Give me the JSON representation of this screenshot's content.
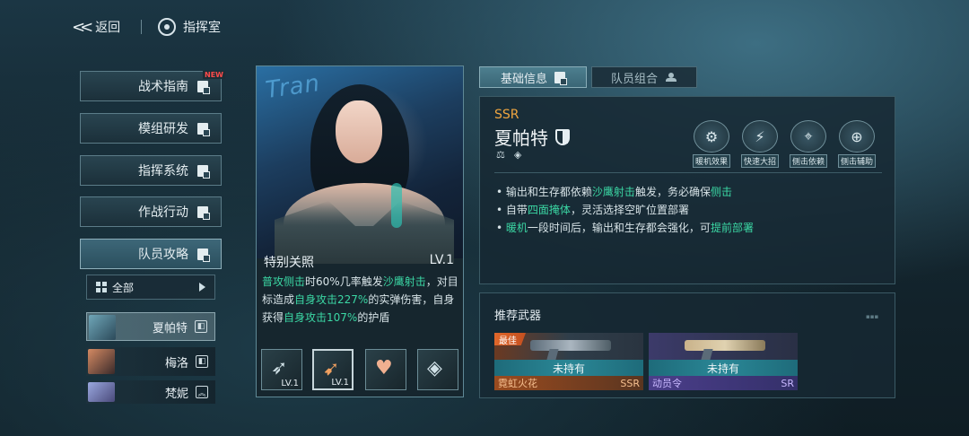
{
  "header": {
    "back_label": "返回",
    "location_label": "指挥室"
  },
  "menu": {
    "new_badge": "NEW",
    "items": [
      {
        "label": "战术指南"
      },
      {
        "label": "模组研发"
      },
      {
        "label": "指挥系统"
      },
      {
        "label": "作战行动"
      },
      {
        "label": "队员攻略"
      }
    ],
    "active_index": 4,
    "filter_label": "全部"
  },
  "characters": [
    {
      "name": "夏帕特",
      "selected": true
    },
    {
      "name": "梅洛",
      "selected": false
    },
    {
      "name": "梵妮",
      "selected": false
    }
  ],
  "skill": {
    "name": "特别关照",
    "level": "LV.1",
    "desc": [
      {
        "t": "普攻侧击",
        "hl": true
      },
      {
        "t": "时60%几率触发",
        "hl": false
      },
      {
        "t": "沙鹰射击",
        "hl": true
      },
      {
        "t": "，对目标造成",
        "hl": false
      },
      {
        "t": "自身攻击227%",
        "hl": true
      },
      {
        "t": "的实弹伤害，自身获得",
        "hl": false
      },
      {
        "t": "自身攻击107%",
        "hl": true
      },
      {
        "t": "的护盾",
        "hl": false
      }
    ],
    "slots": [
      {
        "icon": "arrows-skill-icon",
        "level": "LV.1"
      },
      {
        "icon": "feather-skill-icon",
        "level": "LV.1"
      },
      {
        "icon": "heart-skill-icon",
        "level": ""
      },
      {
        "icon": "crate-skill-icon",
        "level": ""
      }
    ]
  },
  "tabs": [
    {
      "label": "基础信息",
      "active": true
    },
    {
      "label": "队员组合",
      "active": false
    }
  ],
  "info": {
    "rarity": "SSR",
    "name": "夏帕特",
    "tags": [
      {
        "label": "暖机效果",
        "icon": "warmup-icon"
      },
      {
        "label": "快速大招",
        "icon": "lightning-icon"
      },
      {
        "label": "侧击依赖",
        "icon": "crosshair-icon"
      },
      {
        "label": "侧击辅助",
        "icon": "crosshair-plus-icon"
      }
    ],
    "bullets": [
      [
        {
          "t": "输出和生存都依赖",
          "hl": false
        },
        {
          "t": "沙鹰射击",
          "hl": true
        },
        {
          "t": "触发，务必确保",
          "hl": false
        },
        {
          "t": "侧击",
          "hl": true
        }
      ],
      [
        {
          "t": "自带",
          "hl": false
        },
        {
          "t": "四面掩体",
          "hl": true
        },
        {
          "t": "，灵活选择空旷位置部署",
          "hl": false
        }
      ],
      [
        {
          "t": "暖机",
          "hl": true
        },
        {
          "t": "一段时间后，输出和生存都会强化，可",
          "hl": false
        },
        {
          "t": "提前部署",
          "hl": true
        }
      ]
    ]
  },
  "weapons": {
    "title": "推荐武器",
    "items": [
      {
        "name": "霓虹火花",
        "rarity": "SSR",
        "status": "未持有",
        "badge": "最佳",
        "theme": "orange"
      },
      {
        "name": "动员令",
        "rarity": "SR",
        "status": "未持有",
        "badge": "",
        "theme": "purple"
      }
    ]
  },
  "colors": {
    "highlight": "#3bd7a4",
    "rarity_ssr": "#f0a640",
    "new_badge": "#ff4b4b"
  }
}
